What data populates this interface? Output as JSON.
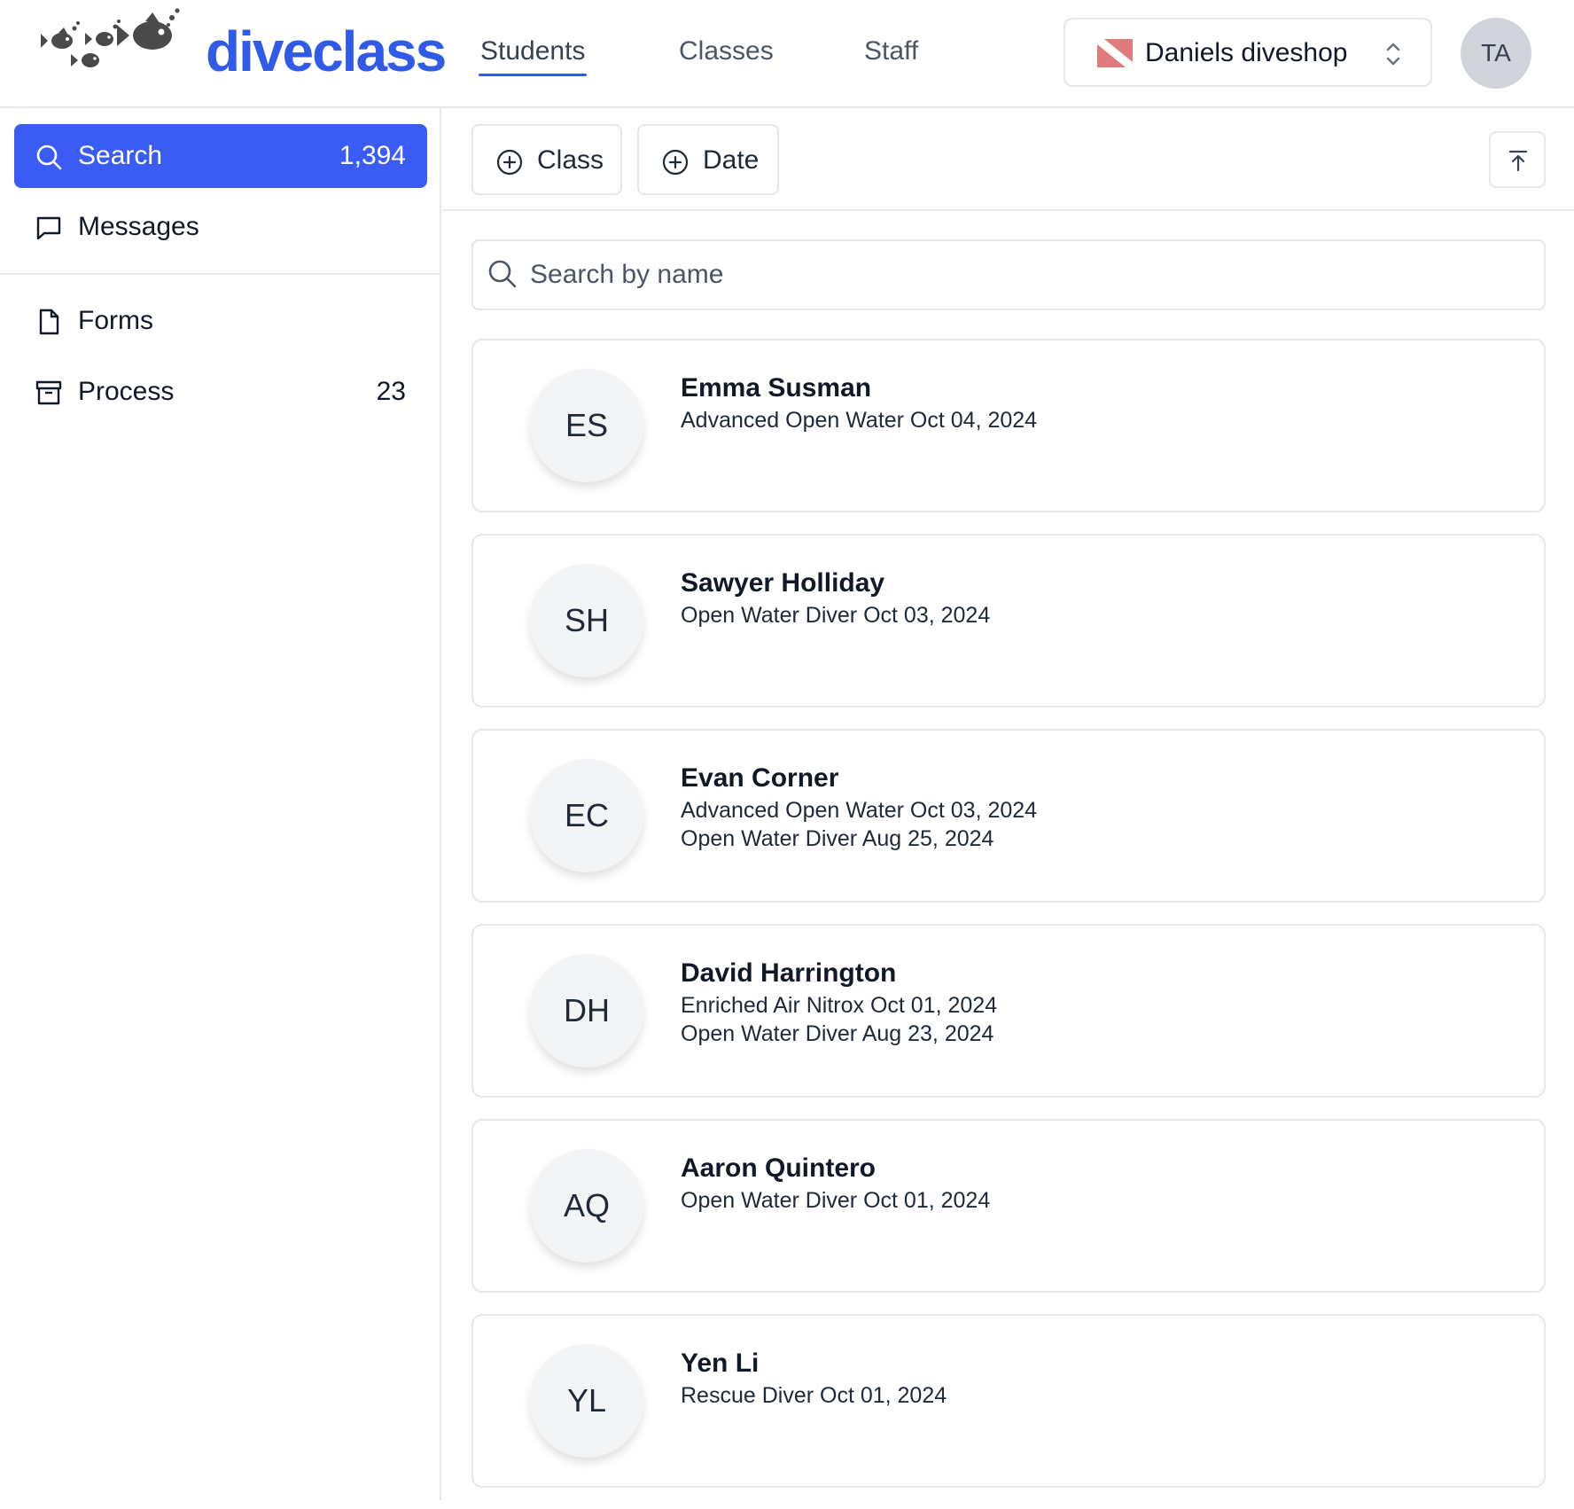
{
  "app": {
    "logo_text": "diveclass"
  },
  "nav": {
    "items": [
      {
        "label": "Students",
        "active": true
      },
      {
        "label": "Classes",
        "active": false
      },
      {
        "label": "Staff",
        "active": false
      }
    ]
  },
  "shop": {
    "name": "Daniels diveshop",
    "flag_colors": {
      "background": "#e07b7b",
      "stripe": "#ffffff"
    }
  },
  "user": {
    "initials": "TA"
  },
  "sidebar": {
    "items": [
      {
        "label": "Search",
        "count": "1,394",
        "icon": "search-icon",
        "active": true
      },
      {
        "label": "Messages",
        "count": "",
        "icon": "message-icon",
        "active": false
      },
      {
        "label": "Forms",
        "count": "",
        "icon": "document-icon",
        "active": false
      },
      {
        "label": "Process",
        "count": "23",
        "icon": "archive-icon",
        "active": false
      }
    ]
  },
  "toolbar": {
    "filters": [
      {
        "label": "Class",
        "icon": "plus-circle-icon"
      },
      {
        "label": "Date",
        "icon": "plus-circle-icon"
      }
    ],
    "top_icon": "arrow-up-to-line-icon"
  },
  "search": {
    "placeholder": "Search by name",
    "value": ""
  },
  "students": [
    {
      "initials": "ES",
      "name": "Emma Susman",
      "classes": [
        "Advanced Open Water Oct 04, 2024"
      ]
    },
    {
      "initials": "SH",
      "name": "Sawyer Holliday",
      "classes": [
        "Open Water Diver Oct 03, 2024"
      ]
    },
    {
      "initials": "EC",
      "name": "Evan Corner",
      "classes": [
        "Advanced Open Water Oct 03, 2024",
        "Open Water Diver Aug 25, 2024"
      ]
    },
    {
      "initials": "DH",
      "name": "David Harrington",
      "classes": [
        "Enriched Air Nitrox Oct 01, 2024",
        "Open Water Diver Aug 23, 2024"
      ]
    },
    {
      "initials": "AQ",
      "name": "Aaron Quintero",
      "classes": [
        "Open Water Diver Oct 01, 2024"
      ]
    },
    {
      "initials": "YL",
      "name": "Yen Li",
      "classes": [
        "Rescue Diver Oct 01, 2024"
      ]
    }
  ],
  "colors": {
    "accent": "#3b5bf5",
    "logo": "#2f5be8",
    "border": "#e5e7eb"
  }
}
